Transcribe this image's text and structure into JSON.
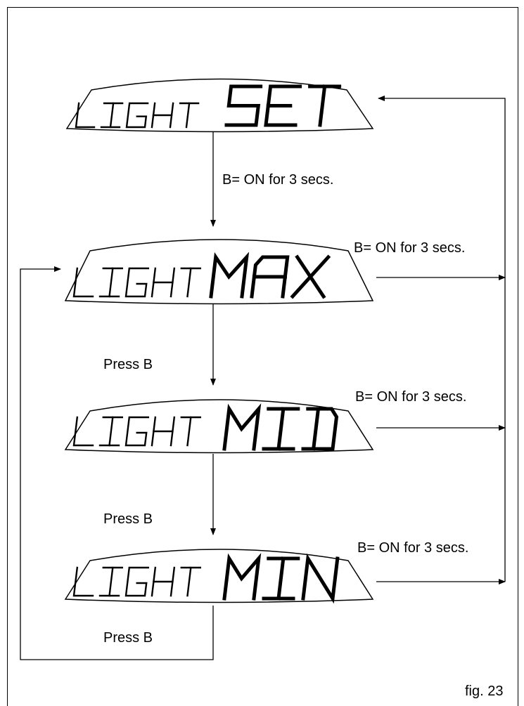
{
  "displays": [
    {
      "word": "LIGHT",
      "mode": "SET"
    },
    {
      "word": "LIGHT",
      "mode": "MAX"
    },
    {
      "word": "LIGHT",
      "mode": "MID"
    },
    {
      "word": "LIGHT",
      "mode": "MIN"
    }
  ],
  "labels": {
    "set_to_max": "B= ON for 3 secs.",
    "max_to_mid": "Press B",
    "mid_to_min": "Press B",
    "min_to_max": "Press B",
    "max_exit": "B= ON for 3 secs.",
    "mid_exit": "B= ON for 3 secs.",
    "min_exit": "B= ON for 3 secs."
  },
  "figure_label": "fig. 23"
}
